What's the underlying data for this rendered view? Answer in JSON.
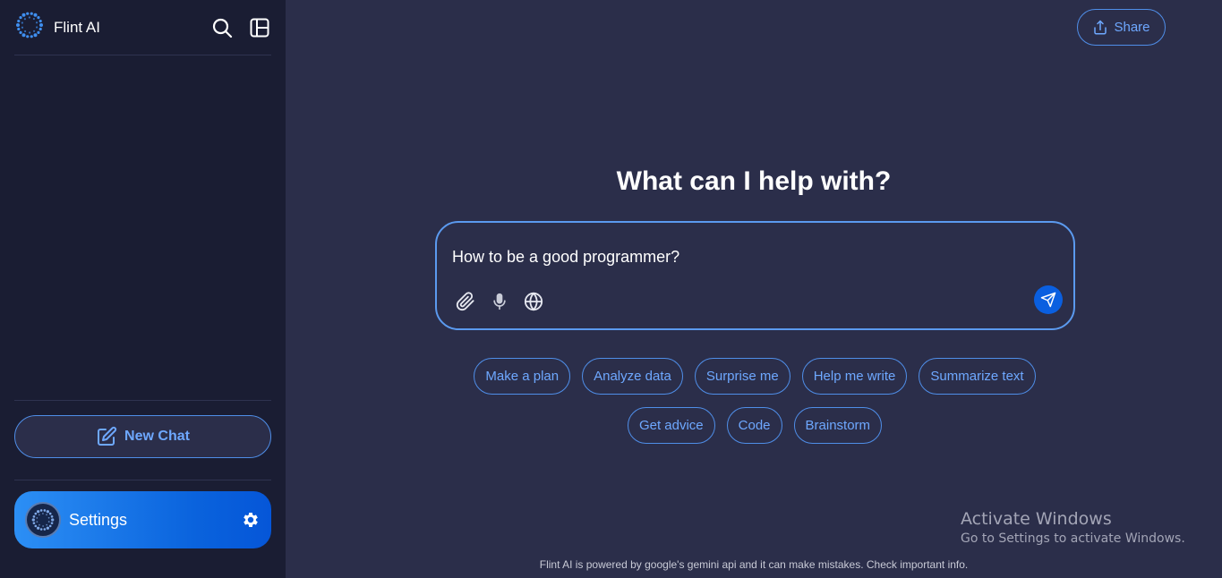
{
  "app": {
    "name": "Flint AI"
  },
  "sidebar": {
    "new_chat_label": "New Chat",
    "settings_label": "Settings"
  },
  "header": {
    "share_label": "Share"
  },
  "main": {
    "headline": "What can I help with?",
    "composer_value": "How to be a good programmer?",
    "chips": [
      "Make a plan",
      "Analyze data",
      "Surprise me",
      "Help me write",
      "Summarize text",
      "Get advice",
      "Code",
      "Brainstorm"
    ],
    "footer": "Flint AI is powered by google's gemini api and it can make mistakes. Check important info."
  },
  "watermark": {
    "title": "Activate Windows",
    "subtitle": "Go to Settings to activate Windows."
  },
  "icons": {
    "logo": "flint-logo-icon",
    "search": "search-icon",
    "sidebar_toggle": "sidebar-toggle-icon",
    "new_chat": "edit-icon",
    "share": "share-icon",
    "attach": "paperclip-icon",
    "mic": "microphone-icon",
    "web": "globe-icon",
    "send": "send-icon",
    "settings": "gear-icon"
  },
  "colors": {
    "accent": "#4f8ee8",
    "accent_text": "#6ea8ff",
    "sidebar_bg": "#1a1d33",
    "main_bg": "#2b2e4a",
    "send_bg": "#0a5fe0"
  }
}
